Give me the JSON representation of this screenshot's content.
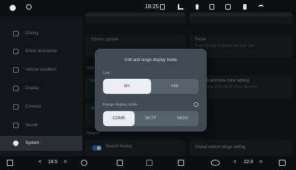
{
  "status_bar": {
    "time": "18:25",
    "icons": [
      "profile-icon",
      "location-icon",
      "pin-icon",
      "signal-icon",
      "mic-icon",
      "bluetooth-icon",
      "screen-icon",
      "volume-icon",
      "wifi-icon"
    ]
  },
  "sidebar": {
    "items": [
      {
        "label": "Driving",
        "icon": "car-icon"
      },
      {
        "label": "Driver assistance",
        "icon": "steering-icon"
      },
      {
        "label": "Vehicle condition",
        "icon": "vehicle-icon"
      },
      {
        "label": "Display",
        "icon": "display-icon"
      },
      {
        "label": "Connect",
        "icon": "connect-icon"
      },
      {
        "label": "Sound",
        "icon": "sound-icon"
      },
      {
        "label": "System",
        "icon": "system-icon",
        "active": true
      }
    ]
  },
  "main": {
    "cards": {
      "system_update": {
        "title": "System update"
      },
      "reset": {
        "title": "Reset",
        "subtitle": "Reset settings to default and clear user"
      },
      "system_time": {
        "title": "System and time zone setting",
        "subtitle": "System time UTC+08:00 China Standard"
      },
      "search_history": {
        "title": "Search history"
      },
      "global_search": {
        "title": "Global search range setting"
      }
    },
    "section_search": "Search",
    "partial_labels": {
      "unit": "Unit",
      "la": "La",
      "up": "Up"
    }
  },
  "modal": {
    "title": "Unit and range display mode",
    "unit_label": "Unit",
    "unit_options": [
      "km",
      "mile"
    ],
    "unit_selected": "km",
    "range_label": "Range display mode",
    "range_options": [
      "COMB",
      "WLTP",
      "NEDC"
    ],
    "range_selected": "COMB"
  },
  "bottom_bar": {
    "left_temp": "19.5",
    "right_temp": "22.0",
    "left_chevron": "<",
    "left_chevron_r": ">",
    "right_chevron": "<",
    "right_chevron_r": ">"
  },
  "colors": {
    "accent": "#2c6fd1",
    "modal_bg": "#3f4a53",
    "selected_bg": "#e9eef2"
  }
}
